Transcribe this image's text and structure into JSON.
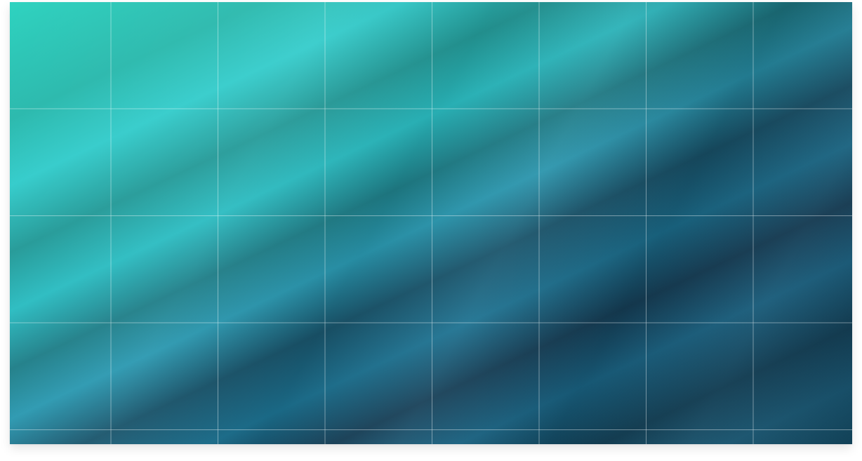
{
  "background": {
    "style": "diagonal-gradient-with-grid",
    "colors": {
      "teal_light": "#2fd3c0",
      "teal_mid": "#2bb9ad",
      "cyan": "#34cccb",
      "blue_mid": "#1c7190",
      "navy": "#163f57",
      "grid_line": "#ffffff"
    }
  }
}
